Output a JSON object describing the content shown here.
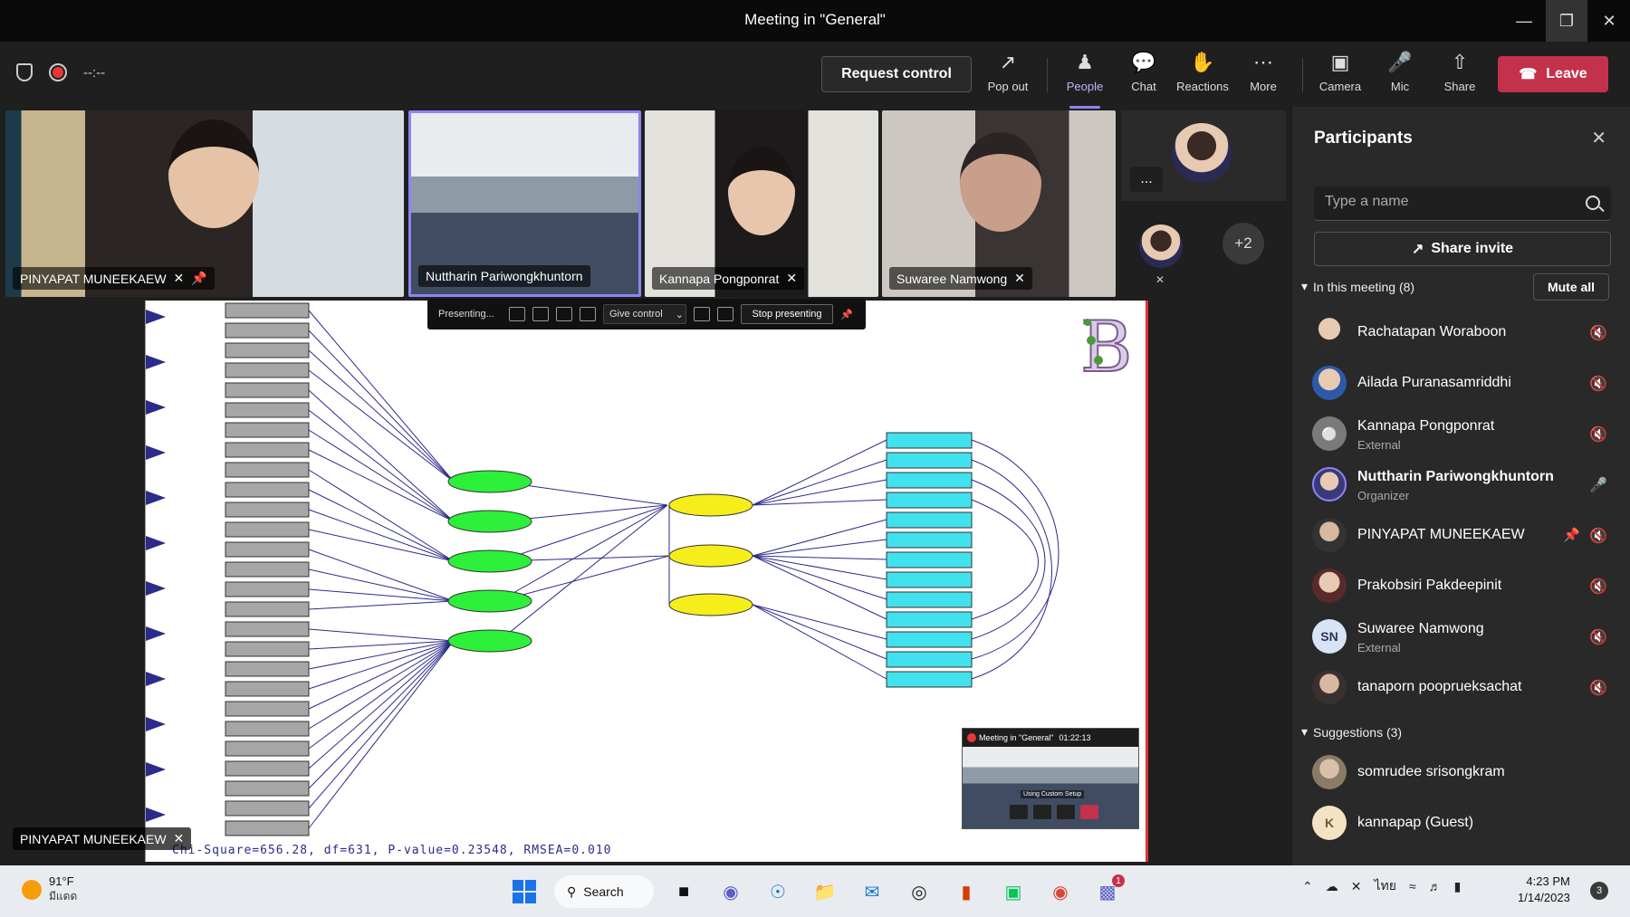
{
  "window": {
    "title": "Meeting in \"General\""
  },
  "toolbar": {
    "timer": "--:--",
    "request_control": "Request control",
    "pop_out": "Pop out",
    "people": "People",
    "chat": "Chat",
    "reactions": "Reactions",
    "more": "More",
    "camera": "Camera",
    "mic": "Mic",
    "share": "Share",
    "leave": "Leave",
    "leave_color": "#c4314b",
    "accent": "#8b86f3"
  },
  "tiles": [
    {
      "name": "PINYAPAT MUNEEKAEW"
    },
    {
      "name": "Nuttharin Pariwongkhuntorn"
    },
    {
      "name": "Kannapa Pongponrat"
    },
    {
      "name": "Suwaree Namwong"
    }
  ],
  "overflow": {
    "more": "...",
    "count": "+2"
  },
  "presenter_bar": {
    "status": "Presenting...",
    "give_control": "Give control",
    "stop": "Stop presenting"
  },
  "slide": {
    "footer": "Chi-Square=656.28, df=631, P-value=0.23548, RMSEA=0.010"
  },
  "pip": {
    "title": "Meeting in \"General\"",
    "time": "01:22:13",
    "sub": "Using Custom Setup"
  },
  "bottom_name": "PINYAPAT MUNEEKAEW",
  "panel": {
    "title": "Participants",
    "search_placeholder": "Type a name",
    "share_invite": "Share invite",
    "in_meeting": "In this meeting (8)",
    "mute_all": "Mute all",
    "participants": [
      {
        "name": "Rachatapan Woraboon",
        "role": ""
      },
      {
        "name": "Ailada Puranasamriddhi",
        "role": ""
      },
      {
        "name": "Kannapa Pongponrat",
        "role": "External"
      },
      {
        "name": "Nuttharin Pariwongkhuntorn",
        "role": "Organizer"
      },
      {
        "name": "PINYAPAT MUNEEKAEW",
        "role": ""
      },
      {
        "name": "Prakobsiri Pakdeepinit",
        "role": ""
      },
      {
        "name": "Suwaree Namwong",
        "role": "External",
        "initials": "SN"
      },
      {
        "name": "tanaporn pooprueksachat",
        "role": ""
      }
    ],
    "suggestions": "Suggestions (3)",
    "suggested": [
      {
        "name": "somrudee srisongkram"
      },
      {
        "name": "kannapap (Guest)",
        "initials": "K"
      }
    ]
  },
  "taskbar": {
    "temp": "91°F",
    "condition": "มีแดด",
    "search": "Search",
    "teams_badge": "1",
    "lang": "ไทย",
    "time": "4:23 PM",
    "date": "1/14/2023",
    "notifications": "3"
  }
}
